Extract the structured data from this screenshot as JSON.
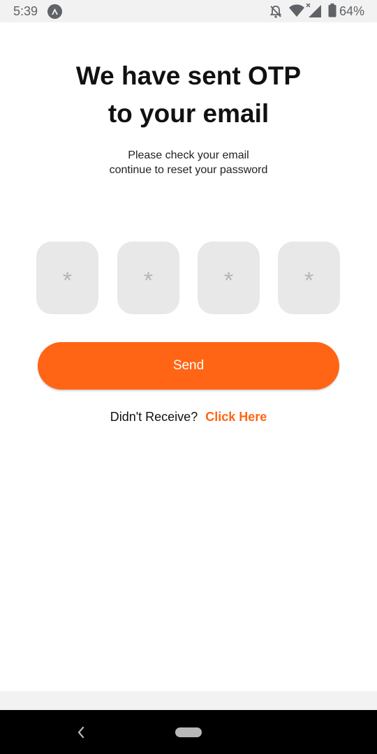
{
  "status_bar": {
    "time": "5:39",
    "battery": "64%",
    "icons": [
      "app-notification-icon",
      "do-not-disturb-icon",
      "wifi-icon",
      "signal-icon",
      "battery-icon"
    ]
  },
  "header": {
    "title_line1": "We have sent OTP",
    "title_line2": "to your email",
    "subtitle_line1": "Please check your email",
    "subtitle_line2": "continue to reset your password"
  },
  "otp": {
    "placeholder": "*",
    "boxes": [
      "*",
      "*",
      "*",
      "*"
    ]
  },
  "actions": {
    "send_label": "Send",
    "resend_prompt": "Didn't Receive?",
    "resend_link": "Click Here"
  },
  "colors": {
    "accent": "#ff6514",
    "otp_box_bg": "#e8e8e8",
    "text": "#111111"
  },
  "nav": {
    "icons": [
      "back-icon",
      "home-pill-icon"
    ]
  }
}
